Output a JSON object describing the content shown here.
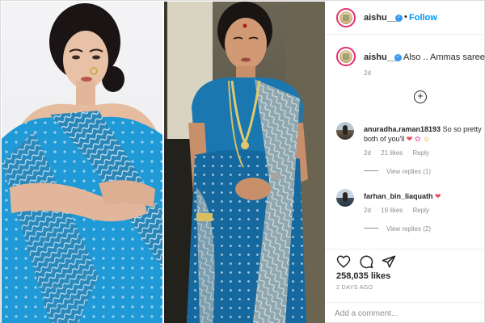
{
  "post": {
    "username": "aishu__",
    "follow_label": "Follow",
    "separator": "•",
    "caption": "Also .. Ammas saree ♥",
    "caption_time": "2d",
    "load_more_icon": "plus-circle-icon"
  },
  "comments": [
    {
      "username": "anuradha.raman18193",
      "text": "So so pretty both of you'll",
      "emoji": [
        "❤",
        "✿",
        "☺"
      ],
      "time": "2d",
      "likes": "21 likes",
      "reply_label": "Reply",
      "view_replies": "View replies (1)"
    },
    {
      "username": "farhan_bin_liaquath",
      "text": "",
      "emoji": [
        "❤"
      ],
      "time": "2d",
      "likes": "19 likes",
      "reply_label": "Reply",
      "view_replies": "View replies (2)"
    }
  ],
  "footer": {
    "likes": "258,035 likes",
    "date": "2 DAYS AGO",
    "comment_placeholder": "Add a comment..."
  },
  "icons": {
    "like": "heart-outline-icon",
    "comment": "comment-bubble-icon",
    "share": "paper-plane-icon"
  },
  "colors": {
    "accent": "#0095f6",
    "verified": "#3897f0",
    "heart": "#ed4956",
    "saree_blue": "#1e9bd7",
    "saree_dark": "#0d4f7e"
  }
}
